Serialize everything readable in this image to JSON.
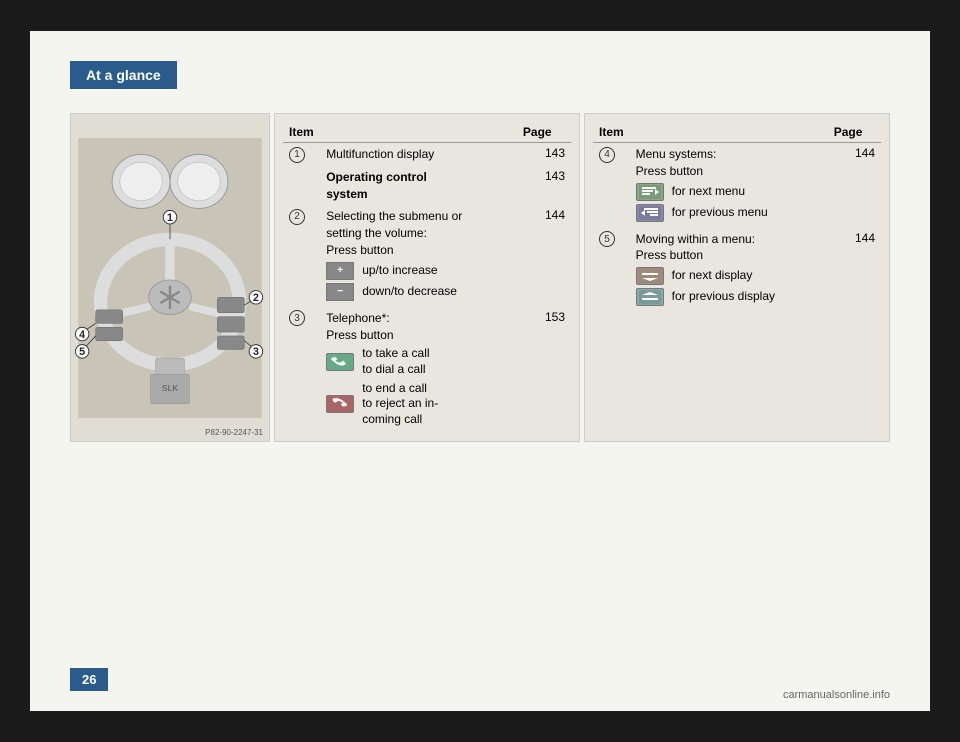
{
  "header": {
    "section_label": "At a glance"
  },
  "page_number": "26",
  "image_caption": "P82-90-2247-31",
  "watermark": "carmanualsonline.info",
  "table1": {
    "col_item": "Item",
    "col_page": "Page",
    "rows": [
      {
        "num": "1",
        "desc": "Multifunction display",
        "bold": false,
        "page": "143"
      },
      {
        "num": "",
        "desc": "Operating control system",
        "bold": true,
        "page": "143"
      },
      {
        "num": "2",
        "desc": "Selecting the submenu or setting the volume:",
        "sub": "Press button",
        "bold": false,
        "page": "144",
        "items": [
          {
            "icon": "+",
            "type": "plus",
            "text": "up/to increase"
          },
          {
            "icon": "−",
            "type": "minus",
            "text": "down/to decrease"
          }
        ]
      },
      {
        "num": "3",
        "desc": "Telephone*:",
        "sub": "Press button",
        "bold": false,
        "page": "153",
        "items": [
          {
            "icon": "📞",
            "type": "phone-green",
            "text": "to take a call\nto dial a call"
          },
          {
            "icon": "📵",
            "type": "phone-red",
            "text": "to end a call\nto reject an in-\ncoming call"
          }
        ]
      }
    ]
  },
  "table2": {
    "col_item": "Item",
    "col_page": "Page",
    "rows": [
      {
        "num": "4",
        "desc": "Menu systems:",
        "sub": "Press button",
        "bold": false,
        "page": "144",
        "items": [
          {
            "icon": "▶",
            "type": "menu-next",
            "text": "for next menu"
          },
          {
            "icon": "◀",
            "type": "menu-prev",
            "text": "for previous menu"
          }
        ]
      },
      {
        "num": "5",
        "desc": "Moving within a menu:",
        "sub": "Press button",
        "bold": false,
        "page": "144",
        "items": [
          {
            "icon": "▲",
            "type": "disp-next",
            "text": "for next display"
          },
          {
            "icon": "▼",
            "type": "disp-prev",
            "text": "for previous display"
          }
        ]
      }
    ]
  },
  "steering_labels": [
    "1",
    "2",
    "3",
    "4",
    "5"
  ]
}
